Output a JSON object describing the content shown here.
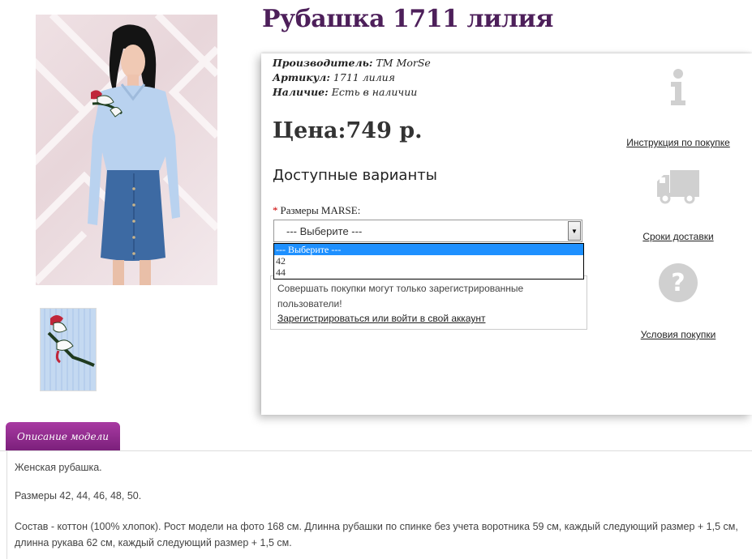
{
  "product": {
    "title": "Рубашка 1711 лилия",
    "manufacturer_label": "Производитель:",
    "manufacturer": "ТМ MorSe",
    "sku_label": "Артикул:",
    "sku": "1711 лилия",
    "stock_label": "Наличие:",
    "stock": "Есть в наличии",
    "price": "Цена:749 р."
  },
  "options": {
    "heading": "Доступные варианты",
    "size_label": "Размеры MARSE:",
    "selected": "--- Выберите ---",
    "list": [
      "--- Выберите ---",
      "42",
      "44"
    ]
  },
  "notice": {
    "text": "Совершать покупки могут только зарегистрированные пользователи!",
    "link": "Зарегистрироваться или войти в свой аккаунт"
  },
  "side": {
    "instruction": "Инструкция по покупке",
    "delivery": "Сроки доставки",
    "terms": "Условия покупки"
  },
  "tabs": {
    "description": "Описание модели"
  },
  "description": {
    "p1": "Женская рубашка.",
    "p2": "Размеры 42, 44, 46, 48, 50.",
    "p3": "Состав - коттон (100% хлопок). Рост модели на фото 168 см. Длинна рубашки по спинке без учета воротника 59 см, каждый следующий размер + 1,5 см, длинна рукава 62 см, каждый следующий размер + 1,5 см."
  },
  "colors": {
    "title": "#4d1f5a",
    "tab": "#8e2a8a",
    "highlight": "#1e90ff",
    "icon": "#d0d0d0"
  }
}
